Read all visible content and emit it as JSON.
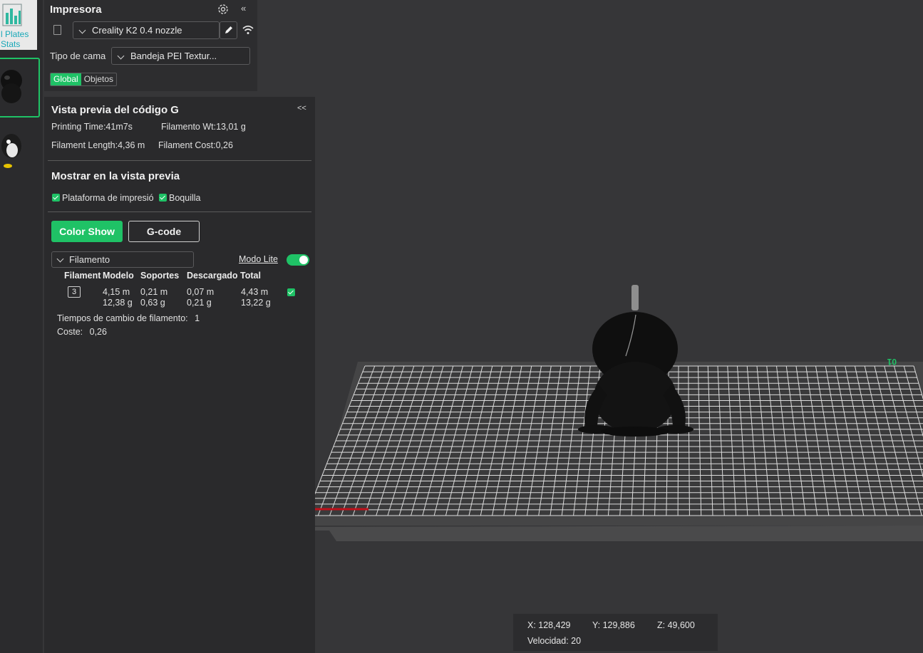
{
  "thumbnails": {
    "stats_label": "l Plates Stats",
    "stats_line1": "l Plates",
    "stats_line2": "Stats"
  },
  "printer": {
    "title": "Impresora",
    "collapse": "«",
    "printer_name": "Creality K2 0.4 nozzle",
    "bed_label": "Tipo de cama",
    "bed_value": "Bandeja PEI Textur...",
    "tabs": [
      "Global",
      "Objetos"
    ],
    "active_tab": "Global"
  },
  "gcode_preview": {
    "title": "Vista previa del código G",
    "collapse": "<<",
    "printing_time": "Printing Time:41m7s",
    "filament_wt": "Filamento Wt:13,01 g",
    "filament_length": "Filament Length:4,36 m",
    "filament_cost": "Filament Cost:0,26",
    "show_title": "Mostrar en la vista previa",
    "show_bed": "Plataforma de impresió",
    "show_nozzle": "Boquilla",
    "btn_color_show": "Color Show",
    "btn_gcode": "G-code",
    "view_select": "Filamento",
    "modo_lite": "Modo Lite",
    "modo_lite_on": true,
    "table": {
      "headers": [
        "Filament",
        "Modelo",
        "Soportes",
        "Descargado",
        "Total"
      ],
      "row": {
        "slot": "3",
        "modelo_m": "4,15 m",
        "modelo_g": "12,38 g",
        "soportes_m": "0,21 m",
        "soportes_g": "0,63 g",
        "descargado_m": "0,07 m",
        "descargado_g": "0,21 g",
        "total_m": "4,43 m",
        "total_g": "13,22 g",
        "visible": true
      }
    },
    "changes_label": "Tiempos de cambio de filamento:",
    "changes_value": "1",
    "cost_label": "Coste:",
    "cost_value": "0,26"
  },
  "viewport": {
    "plate_number": "01",
    "coords": {
      "x": "X: 128,429",
      "y": "Y: 129,886",
      "z": "Z: 49,600",
      "speed": "Velocidad: 20"
    }
  },
  "colors": {
    "accent": "#1fc266",
    "panel": "#2a2a2c",
    "background": "#363638"
  }
}
